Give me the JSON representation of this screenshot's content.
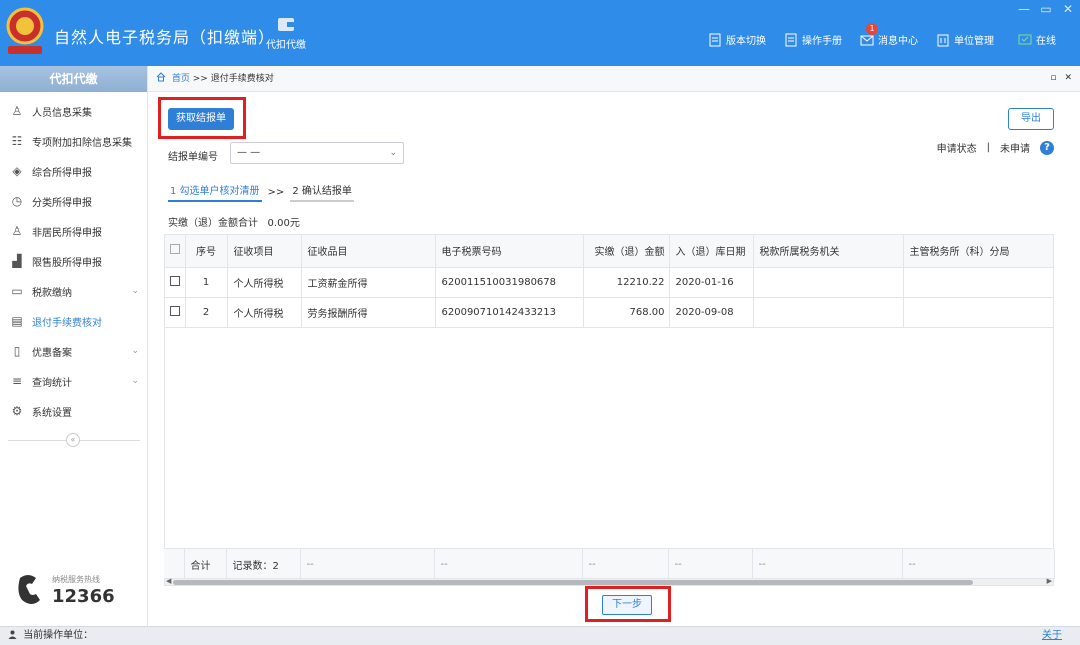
{
  "app": {
    "title": "自然人电子税务局（扣缴端）",
    "module_label": "代扣代缴",
    "window_controls": [
      "—",
      "▭",
      "✕"
    ]
  },
  "topmenu": {
    "version_switch": "版本切换",
    "manual": "操作手册",
    "messages": "消息中心",
    "message_count": "1",
    "unit_manage": "单位管理",
    "online": "在线"
  },
  "sidebar": {
    "header": "代扣代缴",
    "items": [
      {
        "label": "人员信息采集",
        "icon": "person-icon"
      },
      {
        "label": "专项附加扣除信息采集",
        "icon": "list-icon"
      },
      {
        "label": "综合所得申报",
        "icon": "layers-icon"
      },
      {
        "label": "分类所得申报",
        "icon": "clock-icon"
      },
      {
        "label": "非居民所得申报",
        "icon": "person-outline-icon"
      },
      {
        "label": "限售股所得申报",
        "icon": "bar-chart-icon"
      },
      {
        "label": "税款缴纳",
        "icon": "folder-icon"
      },
      {
        "label": "退付手续费核对",
        "icon": "document-icon"
      },
      {
        "label": "优惠备案",
        "icon": "file-icon"
      },
      {
        "label": "查询统计",
        "icon": "search-list-icon"
      },
      {
        "label": "系统设置",
        "icon": "gear-icon"
      }
    ],
    "collapse_glyph": "«",
    "hotline_label": "纳税服务热线",
    "hotline_number": "12366"
  },
  "breadcrumb": {
    "home": "首页",
    "separator": ">>",
    "current": "退付手续费核对"
  },
  "panel_controls": [
    "▫",
    "✕"
  ],
  "toolbar": {
    "get_report_label": "获取结报单",
    "export_label": "导出"
  },
  "filter": {
    "report_no_label": "结报单编号",
    "report_no_value": "— —",
    "status_label": "申请状态",
    "status_sep": "|",
    "status_value": "未申请",
    "help": "?"
  },
  "steps": {
    "step1": "1 勾选单户核对清册",
    "sep": ">>",
    "step2": "2 确认结报单"
  },
  "summary": {
    "label": "实缴（退）金额合计",
    "value": "0.00元"
  },
  "table": {
    "headers": [
      "序号",
      "征收项目",
      "征收品目",
      "电子税票号码",
      "实缴（退）金额",
      "入（退）库日期",
      "税款所属税务机关",
      "主管税务所（科）分局"
    ],
    "rows": [
      {
        "seq": "1",
        "item": "个人所得税",
        "category": "工资薪金所得",
        "ticket": "620011510031980678",
        "amount": "12210.22",
        "date": "2020-01-16",
        "authority": "",
        "bureau": ""
      },
      {
        "seq": "2",
        "item": "个人所得税",
        "category": "劳务报酬所得",
        "ticket": "620090710142433213",
        "amount": "768.00",
        "date": "2020-09-08",
        "authority": "",
        "bureau": ""
      }
    ],
    "footer": {
      "total_label": "合计",
      "record_count": "记录数：2",
      "placeholder": "--"
    }
  },
  "next_label": "下一步",
  "statusbar": {
    "current_unit_label": "当前操作单位：",
    "about": "关于"
  },
  "colors": {
    "titlebar": "#2f8ce8",
    "accent": "#2f7fd6",
    "highlight_box": "#e02020"
  }
}
